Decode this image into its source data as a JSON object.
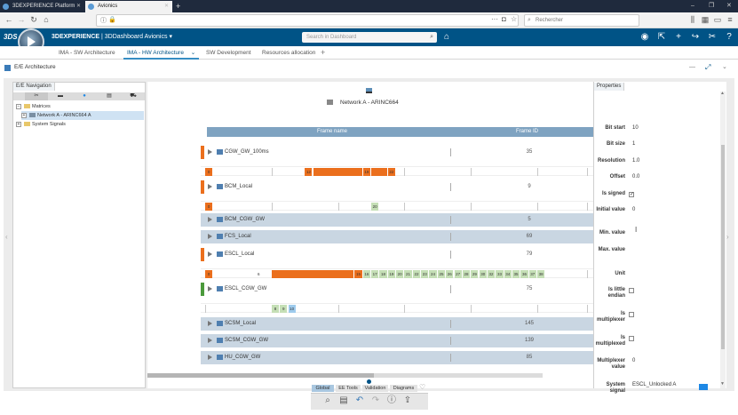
{
  "browser": {
    "tabs": [
      {
        "title": "3DEXPERIENCE Platform"
      },
      {
        "title": "Avionics"
      }
    ],
    "new_tab": "+",
    "search_placeholder": "Rechercher",
    "window_controls": [
      "–",
      "❐",
      "✕"
    ]
  },
  "app": {
    "logo": "3DS",
    "brand": "3DEXPERIENCE",
    "title_rest": " | 3DDashboard Avionics",
    "dashboard_search_placeholder": "Search in Dashboard",
    "tabs": [
      {
        "label": "IMA - SW Architecture",
        "active": false
      },
      {
        "label": "IMA - HW Architecture",
        "active": true
      },
      {
        "label": "SW Development",
        "active": false
      },
      {
        "label": "Resources allocation",
        "active": false
      }
    ],
    "add_tab": "+",
    "widget_title": "E/E Architecture"
  },
  "nav_panel": {
    "title": "E/E Navigation",
    "tree": [
      {
        "label": "Matrices",
        "expander": "−"
      },
      {
        "label": "Network A - ARINC664 A",
        "expander": "+"
      },
      {
        "label": "System Signals",
        "expander": "+"
      }
    ]
  },
  "center": {
    "network_name": "Network A - ARINC664",
    "col_frame_name": "Frame name",
    "col_frame_id": "Frame ID",
    "frames": [
      {
        "name": "CGW_GW_100ms",
        "id": "35",
        "marker": "orange",
        "gray": false
      },
      {
        "name": "BCM_Local",
        "id": "9",
        "marker": "orange",
        "gray": false
      },
      {
        "name": "BCM_CGW_GW",
        "id": "5",
        "marker": "none",
        "gray": true
      },
      {
        "name": "FCS_Local",
        "id": "69",
        "marker": "none",
        "gray": true
      },
      {
        "name": "ESCL_Local",
        "id": "79",
        "marker": "orange",
        "gray": false
      },
      {
        "name": "ESCL_CGW_GW",
        "id": "75",
        "marker": "green",
        "gray": false
      },
      {
        "name": "SCSM_Local",
        "id": "145",
        "marker": "none",
        "gray": true
      },
      {
        "name": "SCSM_CGW_GW",
        "id": "139",
        "marker": "none",
        "gray": true
      },
      {
        "name": "HU_CGW_GW",
        "id": "85",
        "marker": "none",
        "gray": true
      }
    ],
    "bit_rows": [
      {
        "cells": [
          {
            "t": "0",
            "c": "orange",
            "s": 0,
            "w": 1
          },
          {
            "t": "12",
            "c": "orange",
            "s": 12,
            "w": 1
          },
          {
            "t": "",
            "c": "orange",
            "s": 13,
            "w": 6
          },
          {
            "t": "19",
            "c": "orange",
            "s": 19,
            "w": 1
          },
          {
            "t": "",
            "c": "orange",
            "s": 20,
            "w": 2
          },
          {
            "t": "22",
            "c": "orange",
            "s": 22,
            "w": 1
          }
        ]
      },
      {
        "cells": [
          {
            "t": "0",
            "c": "orange",
            "s": 0,
            "w": 1
          },
          {
            "t": "20",
            "c": "lightgreen",
            "s": 20,
            "w": 1
          }
        ]
      },
      {
        "cells": [
          {
            "t": "0",
            "c": "orange",
            "s": 0,
            "w": 1
          },
          {
            "t": "6",
            "c": "none",
            "s": 6,
            "w": 1
          },
          {
            "t": "",
            "c": "orange",
            "s": 8,
            "w": 10
          },
          {
            "t": "15",
            "c": "orange",
            "s": 18,
            "w": 1
          },
          {
            "t": "16",
            "c": "lightgreen",
            "s": 19,
            "w": 1
          },
          {
            "t": "17",
            "c": "lightgreen",
            "s": 20,
            "w": 1
          },
          {
            "t": "18",
            "c": "lightgreen",
            "s": 21,
            "w": 1
          },
          {
            "t": "19",
            "c": "lightgreen",
            "s": 22,
            "w": 1
          },
          {
            "t": "20",
            "c": "lightgreen",
            "s": 23,
            "w": 1
          },
          {
            "t": "21",
            "c": "lightgreen",
            "s": 24,
            "w": 1
          },
          {
            "t": "22",
            "c": "lightgreen",
            "s": 25,
            "w": 1
          },
          {
            "t": "23",
            "c": "lightgreen",
            "s": 26,
            "w": 1
          },
          {
            "t": "24",
            "c": "lightgreen",
            "s": 27,
            "w": 1
          },
          {
            "t": "25",
            "c": "lightgreen",
            "s": 28,
            "w": 1
          },
          {
            "t": "26",
            "c": "lightgreen",
            "s": 29,
            "w": 1
          },
          {
            "t": "27",
            "c": "lightgreen",
            "s": 30,
            "w": 1
          },
          {
            "t": "28",
            "c": "lightgreen",
            "s": 31,
            "w": 1
          },
          {
            "t": "29",
            "c": "lightgreen",
            "s": 32,
            "w": 1
          },
          {
            "t": "30",
            "c": "lightgreen",
            "s": 33,
            "w": 1
          },
          {
            "t": "32",
            "c": "lightgreen",
            "s": 34,
            "w": 1
          },
          {
            "t": "33",
            "c": "lightgreen",
            "s": 35,
            "w": 1
          },
          {
            "t": "34",
            "c": "lightgreen",
            "s": 36,
            "w": 1
          },
          {
            "t": "35",
            "c": "lightgreen",
            "s": 37,
            "w": 1
          },
          {
            "t": "36",
            "c": "lightgreen",
            "s": 38,
            "w": 1
          },
          {
            "t": "37",
            "c": "lightgreen",
            "s": 39,
            "w": 1
          },
          {
            "t": "38",
            "c": "lightgreen",
            "s": 40,
            "w": 1
          }
        ]
      },
      {
        "cells": [
          {
            "t": "8",
            "c": "lightgreen",
            "s": 8,
            "w": 1
          },
          {
            "t": "9",
            "c": "lightgreen",
            "s": 9,
            "w": 1
          },
          {
            "t": "10",
            "c": "lightblue",
            "s": 10,
            "w": 1
          }
        ]
      }
    ],
    "bottom_tabs": [
      {
        "label": "Global",
        "active": true
      },
      {
        "label": "EE Tools",
        "active": false
      },
      {
        "label": "Validation",
        "active": false
      },
      {
        "label": "Diagrams",
        "active": false
      }
    ]
  },
  "properties": {
    "title": "Properties",
    "fields": [
      {
        "label": "Bit start",
        "value": "10",
        "type": "text"
      },
      {
        "label": "Bit size",
        "value": "1",
        "type": "text"
      },
      {
        "label": "Resolution",
        "value": "1.0",
        "type": "text"
      },
      {
        "label": "Offset",
        "value": "0.0",
        "type": "text"
      },
      {
        "label": "Is signed",
        "value": "checked",
        "type": "check"
      },
      {
        "label": "Initial value",
        "value": "0",
        "type": "text"
      },
      {
        "label": "Min. value",
        "value": "",
        "type": "text"
      },
      {
        "label": "Max. value",
        "value": "",
        "type": "text"
      },
      {
        "label": "Unit",
        "value": "",
        "type": "text"
      },
      {
        "label": "Is little endian",
        "value": "unchecked",
        "type": "check"
      },
      {
        "label": "Is multiplexer",
        "value": "unchecked",
        "type": "check"
      },
      {
        "label": "Is multiplexed",
        "value": "unchecked",
        "type": "check"
      },
      {
        "label": "Multiplexer value",
        "value": "0",
        "type": "text"
      },
      {
        "label": "System signal",
        "value": "ESCL_Unlocked A",
        "type": "text"
      }
    ]
  },
  "colors": {
    "app_bar": "#005386",
    "orange": "#eb6f1d",
    "green": "#4b9a3c",
    "lightgreen": "#c5dfb6",
    "lightblue": "#9ecbed",
    "header_blue": "#7fa3c1"
  }
}
